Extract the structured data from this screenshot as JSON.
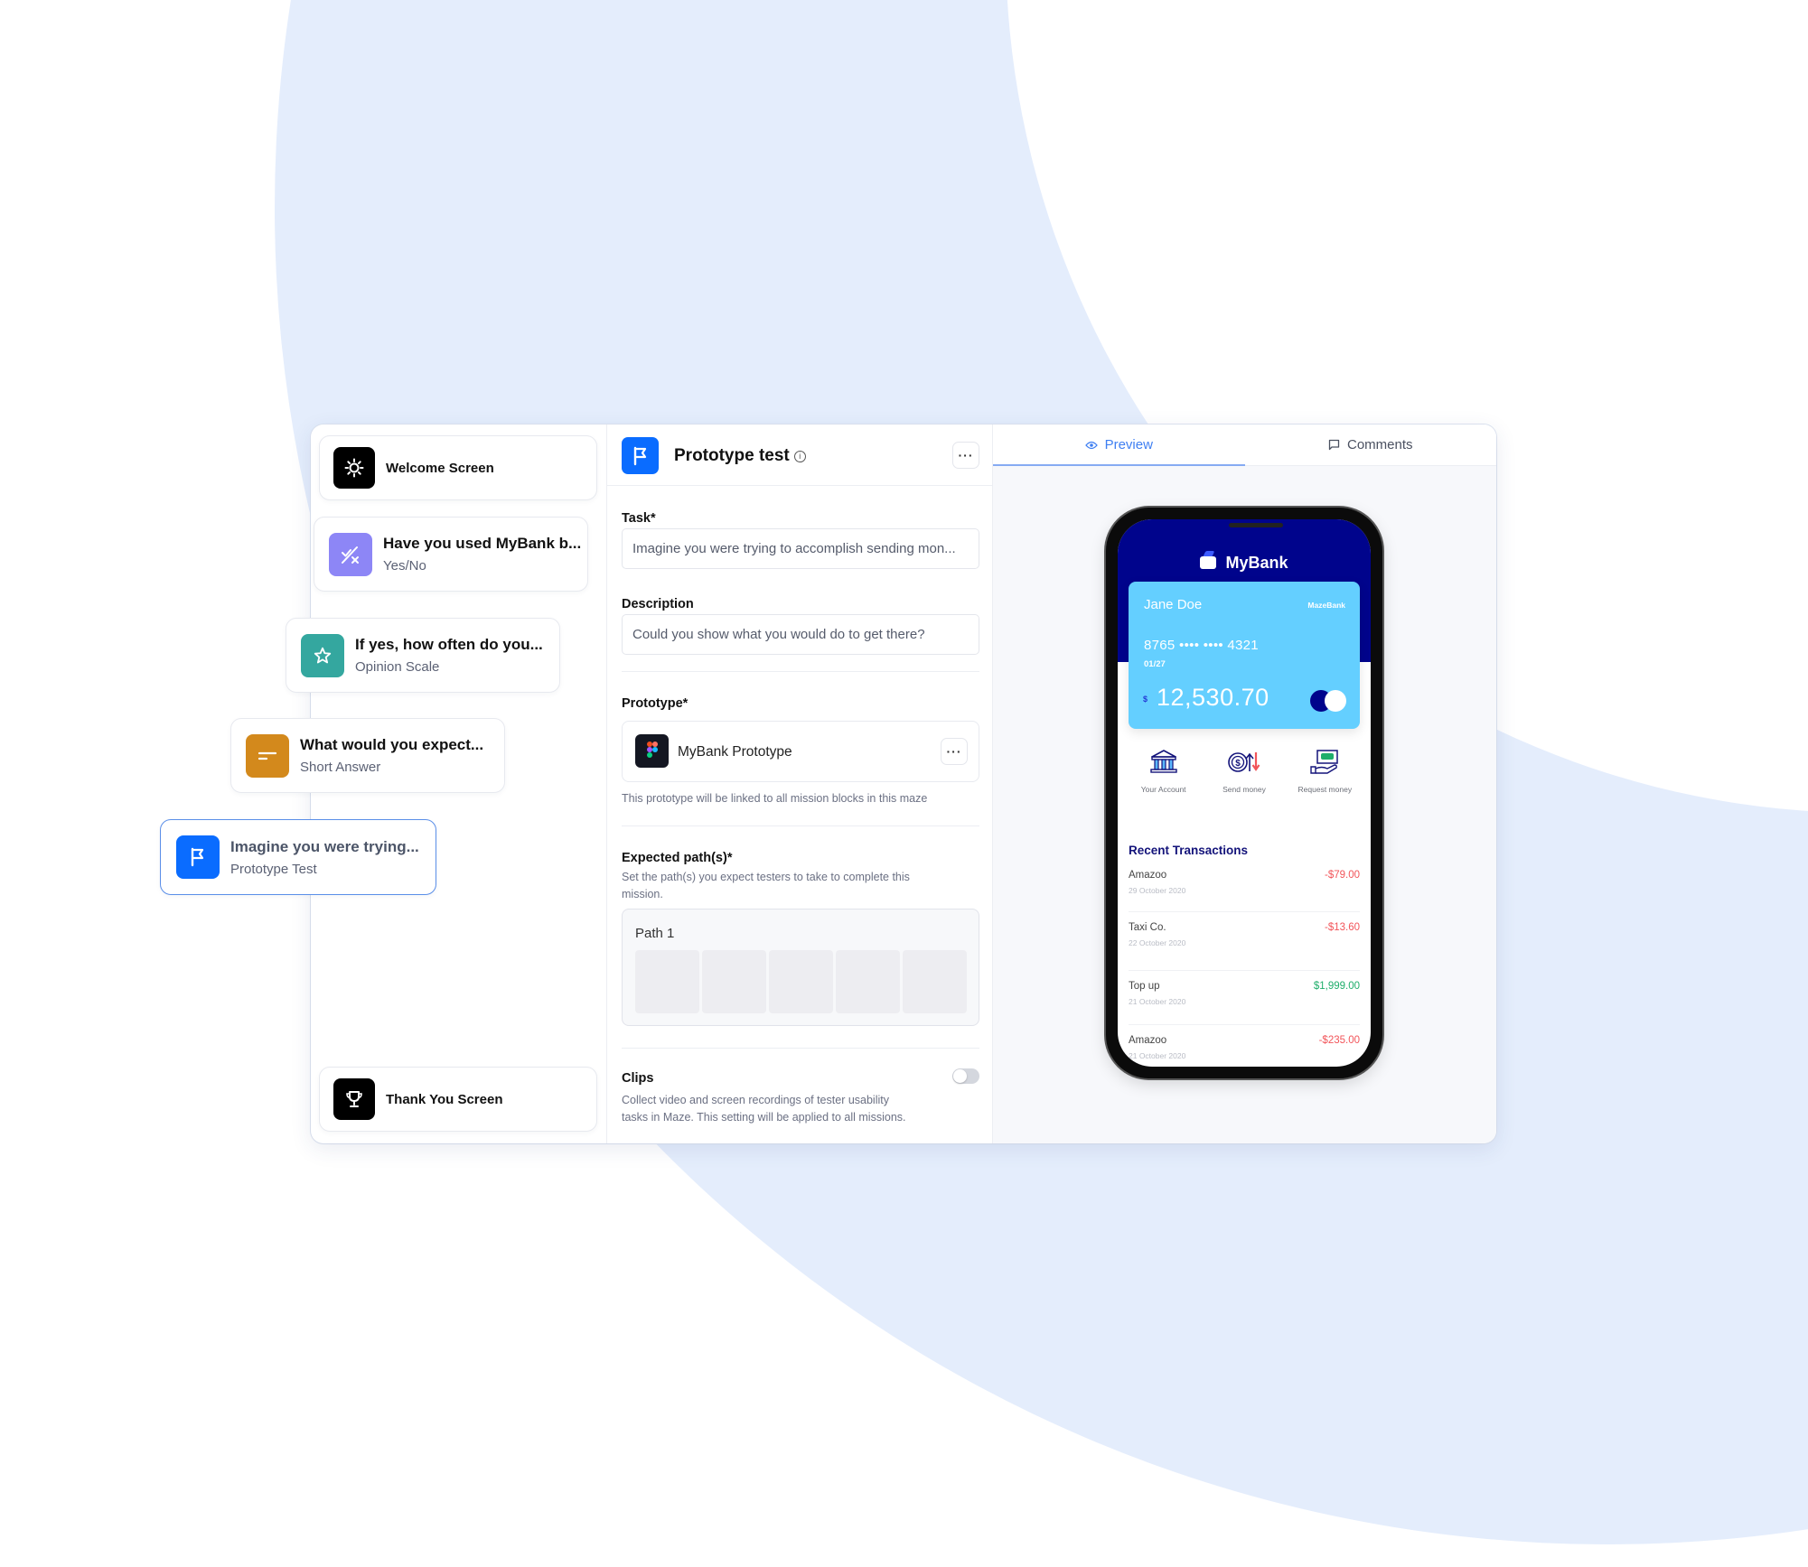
{
  "colors": {
    "accent": "#0a6cff",
    "background_blue": "#e4edfc",
    "welcome_icon_bg": "#000000",
    "yesno_icon_bg": "#8d86f6",
    "opinion_icon_bg": "#34a79f",
    "short_answer_icon_bg": "#d3891c",
    "prototype_icon_bg": "#0a6cff",
    "bank_header": "#00048c",
    "bank_card": "#64cfff",
    "negative": "#f2555a",
    "positive": "#1fae6b"
  },
  "flow": {
    "blocks": [
      {
        "title": "Welcome Screen",
        "subtitle": "",
        "icon": "sun-icon"
      },
      {
        "title": "Have you used MyBank b...",
        "subtitle": "Yes/No",
        "icon": "yes-no-icon"
      },
      {
        "title": "If yes, how often do you...",
        "subtitle": "Opinion Scale",
        "icon": "star-icon"
      },
      {
        "title": "What would you expect...",
        "subtitle": "Short Answer",
        "icon": "short-answer-icon"
      },
      {
        "title": "Imagine you were trying...",
        "subtitle": "Prototype Test",
        "icon": "flag-icon",
        "selected": true
      },
      {
        "title": "Thank You Screen",
        "subtitle": "",
        "icon": "trophy-icon"
      }
    ]
  },
  "editor": {
    "title": "Prototype test",
    "info_icon": "info-icon",
    "more_label": "···",
    "task": {
      "label": "Task*",
      "value": "Imagine you were trying to accomplish sending mon..."
    },
    "description": {
      "label": "Description",
      "value": "Could you show what you would do to get there?"
    },
    "prototype": {
      "label": "Prototype*",
      "name": "MyBank Prototype",
      "help": "This prototype will be linked to all mission blocks in this maze"
    },
    "expected_paths": {
      "label": "Expected path(s)*",
      "help_line1": "Set the path(s) you expect testers to take to complete this",
      "help_line2": "mission.",
      "paths": [
        {
          "name": "Path 1",
          "screens": 5
        }
      ]
    },
    "clips": {
      "label": "Clips",
      "enabled": false,
      "help_line1": "Collect video and screen recordings of tester usability",
      "help_line2": "tasks in Maze. This setting will be applied to all missions."
    }
  },
  "preview_panel": {
    "tabs": [
      {
        "label": "Preview",
        "icon": "eye-icon",
        "active": true
      },
      {
        "label": "Comments",
        "icon": "comment-icon",
        "active": false
      }
    ]
  },
  "bank_app": {
    "app_name": "MyBank",
    "card": {
      "holder": "Jane Doe",
      "brand": "MazeBank",
      "number": "8765 •••• •••• 4321",
      "expiry": "01/27",
      "currency": "$",
      "balance": "12,530.70"
    },
    "actions": [
      {
        "label": "Your Account",
        "icon": "bank-icon"
      },
      {
        "label": "Send money",
        "icon": "send-money-icon"
      },
      {
        "label": "Request money",
        "icon": "request-money-icon"
      }
    ],
    "recent_title": "Recent Transactions",
    "transactions": [
      {
        "name": "Amazoo",
        "date": "29 October 2020",
        "amount": "-$79.00",
        "type": "negative"
      },
      {
        "name": "Taxi Co.",
        "date": "22 October 2020",
        "amount": "-$13.60",
        "type": "negative"
      },
      {
        "name": "Top up",
        "date": "21 October 2020",
        "amount": "$1,999.00",
        "type": "positive"
      },
      {
        "name": "Amazoo",
        "date": "21 October 2020",
        "amount": "-$235.00",
        "type": "negative"
      }
    ]
  }
}
